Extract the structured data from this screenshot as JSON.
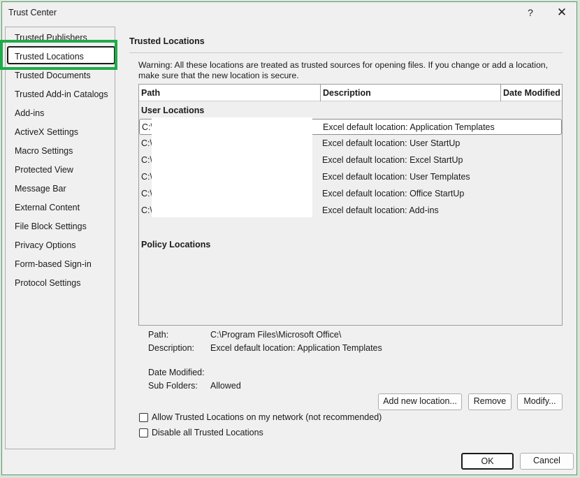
{
  "window": {
    "title": "Trust Center",
    "help_label": "?",
    "close_label": "✕"
  },
  "nav": {
    "items": [
      {
        "label": "Trusted Publishers"
      },
      {
        "label": "Trusted Locations",
        "selected": true
      },
      {
        "label": "Trusted Documents"
      },
      {
        "label": "Trusted Add-in Catalogs"
      },
      {
        "label": "Add-ins"
      },
      {
        "label": "ActiveX Settings"
      },
      {
        "label": "Macro Settings"
      },
      {
        "label": "Protected View"
      },
      {
        "label": "Message Bar"
      },
      {
        "label": "External Content"
      },
      {
        "label": "File Block Settings"
      },
      {
        "label": "Privacy Options"
      },
      {
        "label": "Form-based Sign-in"
      },
      {
        "label": "Protocol Settings"
      }
    ]
  },
  "main": {
    "title": "Trusted Locations",
    "warning": "Warning: All these locations are treated as trusted sources for opening files.  If you change or add a location, make sure that the new location is secure.",
    "table": {
      "columns": [
        "Path",
        "Description",
        "Date Modified"
      ],
      "user_group": "User Locations",
      "policy_group": "Policy Locations",
      "rows": [
        {
          "path": "C:\\",
          "description": "Excel default location: Application Templates",
          "selected": true
        },
        {
          "path": "C:\\",
          "description": "Excel default location: User StartUp"
        },
        {
          "path": "C:\\",
          "description": "Excel default location: Excel StartUp"
        },
        {
          "path": "C:\\",
          "description": "Excel default location: User Templates"
        },
        {
          "path": "C:\\",
          "description": "Excel default location: Office StartUp"
        },
        {
          "path": "C:\\",
          "description": "Excel default location: Add-ins"
        }
      ]
    },
    "details": {
      "path_label": "Path:",
      "path_value": "C:\\Program Files\\Microsoft Office\\",
      "description_label": "Description:",
      "description_value": "Excel default location: Application Templates",
      "date_label": "Date Modified:",
      "date_value": "",
      "subfolders_label": "Sub Folders:",
      "subfolders_value": "Allowed"
    },
    "buttons": {
      "add": "Add new location...",
      "remove": "Remove",
      "modify": "Modify..."
    },
    "checkboxes": {
      "allow_network": "Allow Trusted Locations on my network (not recommended)",
      "allow_network_checked": false,
      "disable_all": "Disable all Trusted Locations",
      "disable_all_checked": false
    }
  },
  "footer": {
    "ok": "OK",
    "cancel": "Cancel"
  },
  "colors": {
    "highlight": "#1faa4a",
    "dialog_bg": "#f0f0f0"
  }
}
